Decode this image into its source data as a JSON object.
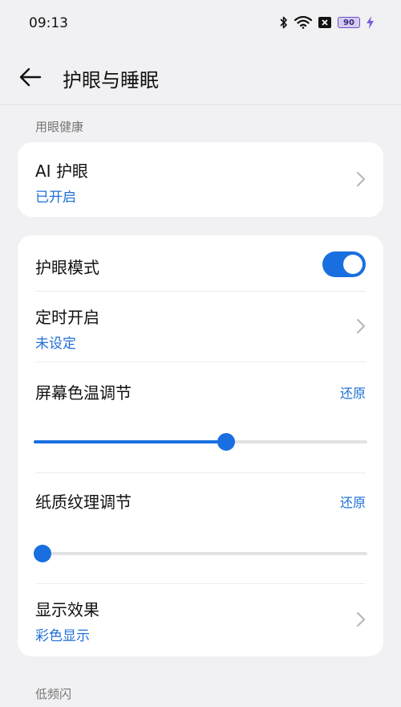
{
  "status_bar": {
    "time": "09:13",
    "battery_level": "90",
    "icons": [
      "bluetooth-icon",
      "wifi-icon",
      "sim-off-icon",
      "battery-icon",
      "charging-icon"
    ]
  },
  "header": {
    "title": "护眼与睡眠"
  },
  "sections": {
    "eye_health_title": "用眼健康",
    "low_flicker_title": "低频闪"
  },
  "ai_eye_care": {
    "title": "AI 护眼",
    "status": "已开启"
  },
  "eye_care_mode": {
    "title": "护眼模式",
    "enabled": true
  },
  "scheduled": {
    "title": "定时开启",
    "status": "未设定"
  },
  "color_temp": {
    "title": "屏幕色温调节",
    "reset_label": "还原",
    "value_fraction": 0.58
  },
  "paper_texture": {
    "title": "纸质纹理调节",
    "reset_label": "还原",
    "value_fraction": 0.0
  },
  "display_effect": {
    "title": "显示效果",
    "status": "彩色显示"
  },
  "colors": {
    "accent": "#1a6fe0",
    "link": "#1f6fd6",
    "background": "#f1f1f3",
    "card": "#ffffff"
  }
}
